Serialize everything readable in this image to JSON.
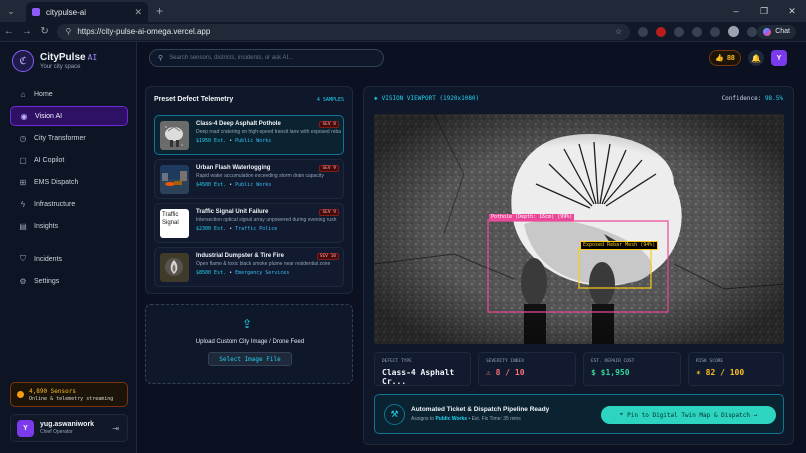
{
  "browser": {
    "tab_title": "citypulse-ai",
    "url": "https://city-pulse-ai-omega.vercel.app",
    "chat_label": "Chat"
  },
  "brand": {
    "name": "CityPulse",
    "ai_suffix": "AI",
    "tagline": "Your city space"
  },
  "sidebar": {
    "items": [
      {
        "label": "Home",
        "icon": "home-icon"
      },
      {
        "label": "Vision AI",
        "icon": "eye-icon"
      },
      {
        "label": "City Transformer",
        "icon": "transformer-icon"
      },
      {
        "label": "AI Copilot",
        "icon": "copilot-icon"
      },
      {
        "label": "EMS Dispatch",
        "icon": "ambulance-icon"
      },
      {
        "label": "Infrastructure",
        "icon": "bolt-icon"
      },
      {
        "label": "Insights",
        "icon": "chart-icon"
      },
      {
        "label": "Incidents",
        "icon": "shield-icon"
      },
      {
        "label": "Settings",
        "icon": "gear-icon"
      }
    ],
    "sensors_title": "4,890 Sensors",
    "sensors_sub": "Online & telemetry streaming",
    "user_initial": "Y",
    "user_name": "yug.aswaniwork",
    "user_role": "Chief Operator"
  },
  "topbar": {
    "search_placeholder": "Search sensors, districts, incidents, or ask AI...",
    "coins": "88",
    "avatar_initial": "Y"
  },
  "presets": {
    "heading": "Preset Defect Telemetry",
    "count": "4 SAMPLES",
    "items": [
      {
        "title": "Class-4 Deep Asphalt Pothole",
        "desc": "Deep road cratering on high-speed transit lane with exposed rebar",
        "price": "$1950 Est.",
        "dept": "Public Works",
        "sev": "SEV 8"
      },
      {
        "title": "Urban Flash Waterlogging",
        "desc": "Rapid water accumulation exceeding storm drain capacity",
        "price": "$4500 Est.",
        "dept": "Public Works",
        "sev": "SEV 9"
      },
      {
        "title": "Traffic Signal Unit Failure",
        "desc": "Intersection optical signal array unpowered during evening rush",
        "price": "$2300 Est.",
        "dept": "Traffic Police",
        "sev": "SEV 9"
      },
      {
        "title": "Industrial Dumpster & Tire Fire",
        "desc": "Open flame & toxic black smoke plume near residential zone",
        "price": "$8500 Est.",
        "dept": "Emergency Services",
        "sev": "SEV 10"
      }
    ],
    "broken_img_alt": [
      "Traffic",
      "Signal"
    ]
  },
  "upload": {
    "label": "Upload Custom City Image / Drone Feed",
    "button": "Select Image File"
  },
  "viewport": {
    "title": "VISION VIEWPORT (1920x1080)",
    "confidence_label": "Confidence:",
    "confidence_value": "98.5%",
    "box1_label": "Pothole (Depth: 16cm) (99%)",
    "box2_label": "Exposed Rebar Mesh (94%)"
  },
  "stats": [
    {
      "label": "DEFECT TYPE",
      "value": "Class-4 Asphalt Cr...",
      "color": "#f1f5f9",
      "icon": ""
    },
    {
      "label": "SEVERITY INDEX",
      "value": "8 / 10",
      "color": "#f87171",
      "icon": "warning-icon"
    },
    {
      "label": "EST. REPAIR COST",
      "value": "$1,950",
      "color": "#34d399",
      "icon": "dollar-icon"
    },
    {
      "label": "RISK SCORE",
      "value": "82 / 100",
      "color": "#fbbf24",
      "icon": "sparkle-icon"
    }
  ],
  "dispatch": {
    "title": "Automated Ticket & Dispatch Pipeline Ready",
    "assign_prefix": "Assigns to",
    "dept": "Public Works",
    "eta": "• Est. Fix Time: 35 mins",
    "button": "Pin to Digital Twin Map & Dispatch →"
  }
}
